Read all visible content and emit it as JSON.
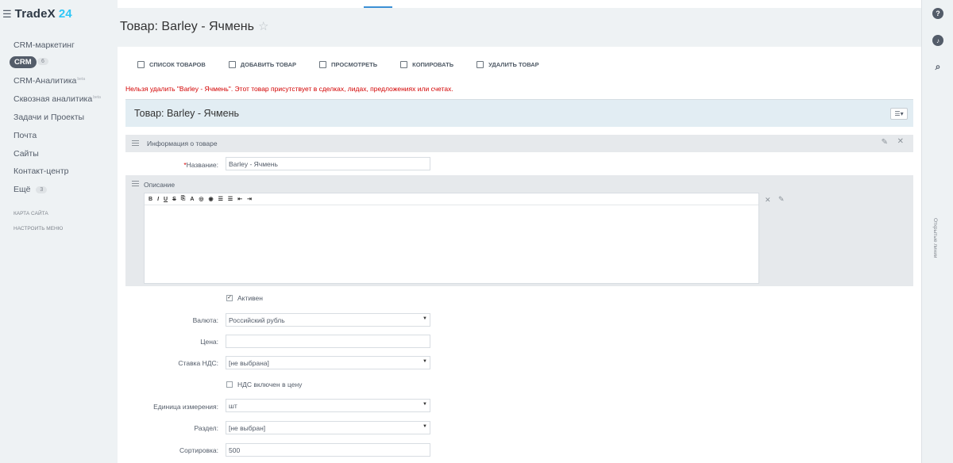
{
  "app": {
    "logo_name": "TradeX",
    "logo_num": "24"
  },
  "sidebar": {
    "items": [
      {
        "label": "CRM-маркетинг",
        "sup": ""
      },
      {
        "label": "CRM",
        "badge": "6"
      },
      {
        "label": "CRM-Аналитика",
        "sup": "beta"
      },
      {
        "label": "Сквозная аналитика",
        "sup": "beta"
      },
      {
        "label": "Задачи и Проекты",
        "sup": ""
      },
      {
        "label": "Почта",
        "sup": ""
      },
      {
        "label": "Сайты",
        "sup": ""
      },
      {
        "label": "Контакт-центр",
        "sup": ""
      },
      {
        "label": "Ещё",
        "badge": "3"
      }
    ],
    "sitemap": "Карта сайта",
    "configure": "Настроить меню"
  },
  "right_rail": {
    "vertical_text": "Открытые линии"
  },
  "page": {
    "title": "Товар: Barley - Ячмень",
    "toolbar": [
      {
        "label": "Список товаров",
        "icon": "list-icon"
      },
      {
        "label": "Добавить товар",
        "icon": "add-icon"
      },
      {
        "label": "Просмотреть",
        "icon": "view-icon"
      },
      {
        "label": "Копировать",
        "icon": "copy-icon"
      },
      {
        "label": "Удалить товар",
        "icon": "delete-icon"
      }
    ],
    "error": "Нельзя удалить \"Barley - Ячмень\". Этот товар присутствует в сделках, лидах, предложениях или счетах."
  },
  "form": {
    "header_title": "Товар: Barley - Ячмень",
    "section_title": "Информация о товаре",
    "name_label": "Название:",
    "name_value": "Barley - Ячмень",
    "description_label": "Описание",
    "editor_buttons": [
      "B",
      "I",
      "U",
      "S",
      "⎘",
      "A",
      "◎",
      "◉",
      "☰",
      "☰",
      "⇤",
      "⇥"
    ],
    "active_label": "Активен",
    "active_checked": true,
    "currency_label": "Валюта:",
    "currency_value": "Российский рубль",
    "price_label": "Цена:",
    "price_value": "",
    "vat_rate_label": "Ставка НДС:",
    "vat_rate_value": "[не выбрана]",
    "vat_included_label": "НДС включен в цену",
    "vat_included_checked": false,
    "unit_label": "Единица измерения:",
    "unit_value": "шт",
    "section_label": "Раздел:",
    "section_value": "[не выбран]",
    "sort_label": "Сортировка:",
    "sort_value": "500"
  },
  "colors": {
    "accent": "#2fc6f6",
    "error": "#d30000",
    "header_bg": "#e2edf3"
  }
}
